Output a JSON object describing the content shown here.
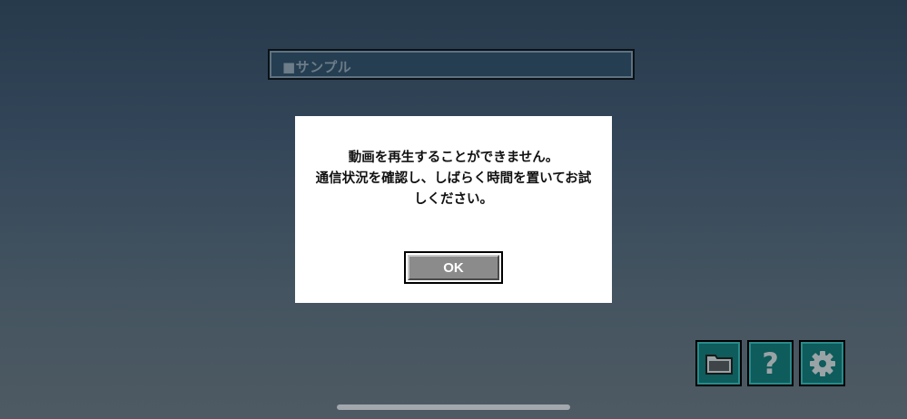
{
  "header": {
    "title": "■サンプル"
  },
  "dialog": {
    "message_lines": [
      "動画を再生することができません。",
      "通信状況を確認し、しばらく時間を置いてお試",
      "しください。"
    ],
    "ok_label": "OK"
  },
  "toolbar": {
    "folder_icon": "folder-icon",
    "help_icon": "help-icon",
    "help_glyph": "?",
    "settings_icon": "gear-icon"
  },
  "colors": {
    "toolbar_button": "#0e5c5c",
    "ok_button": "#8b8b8b",
    "title_bar": "#253e51"
  }
}
